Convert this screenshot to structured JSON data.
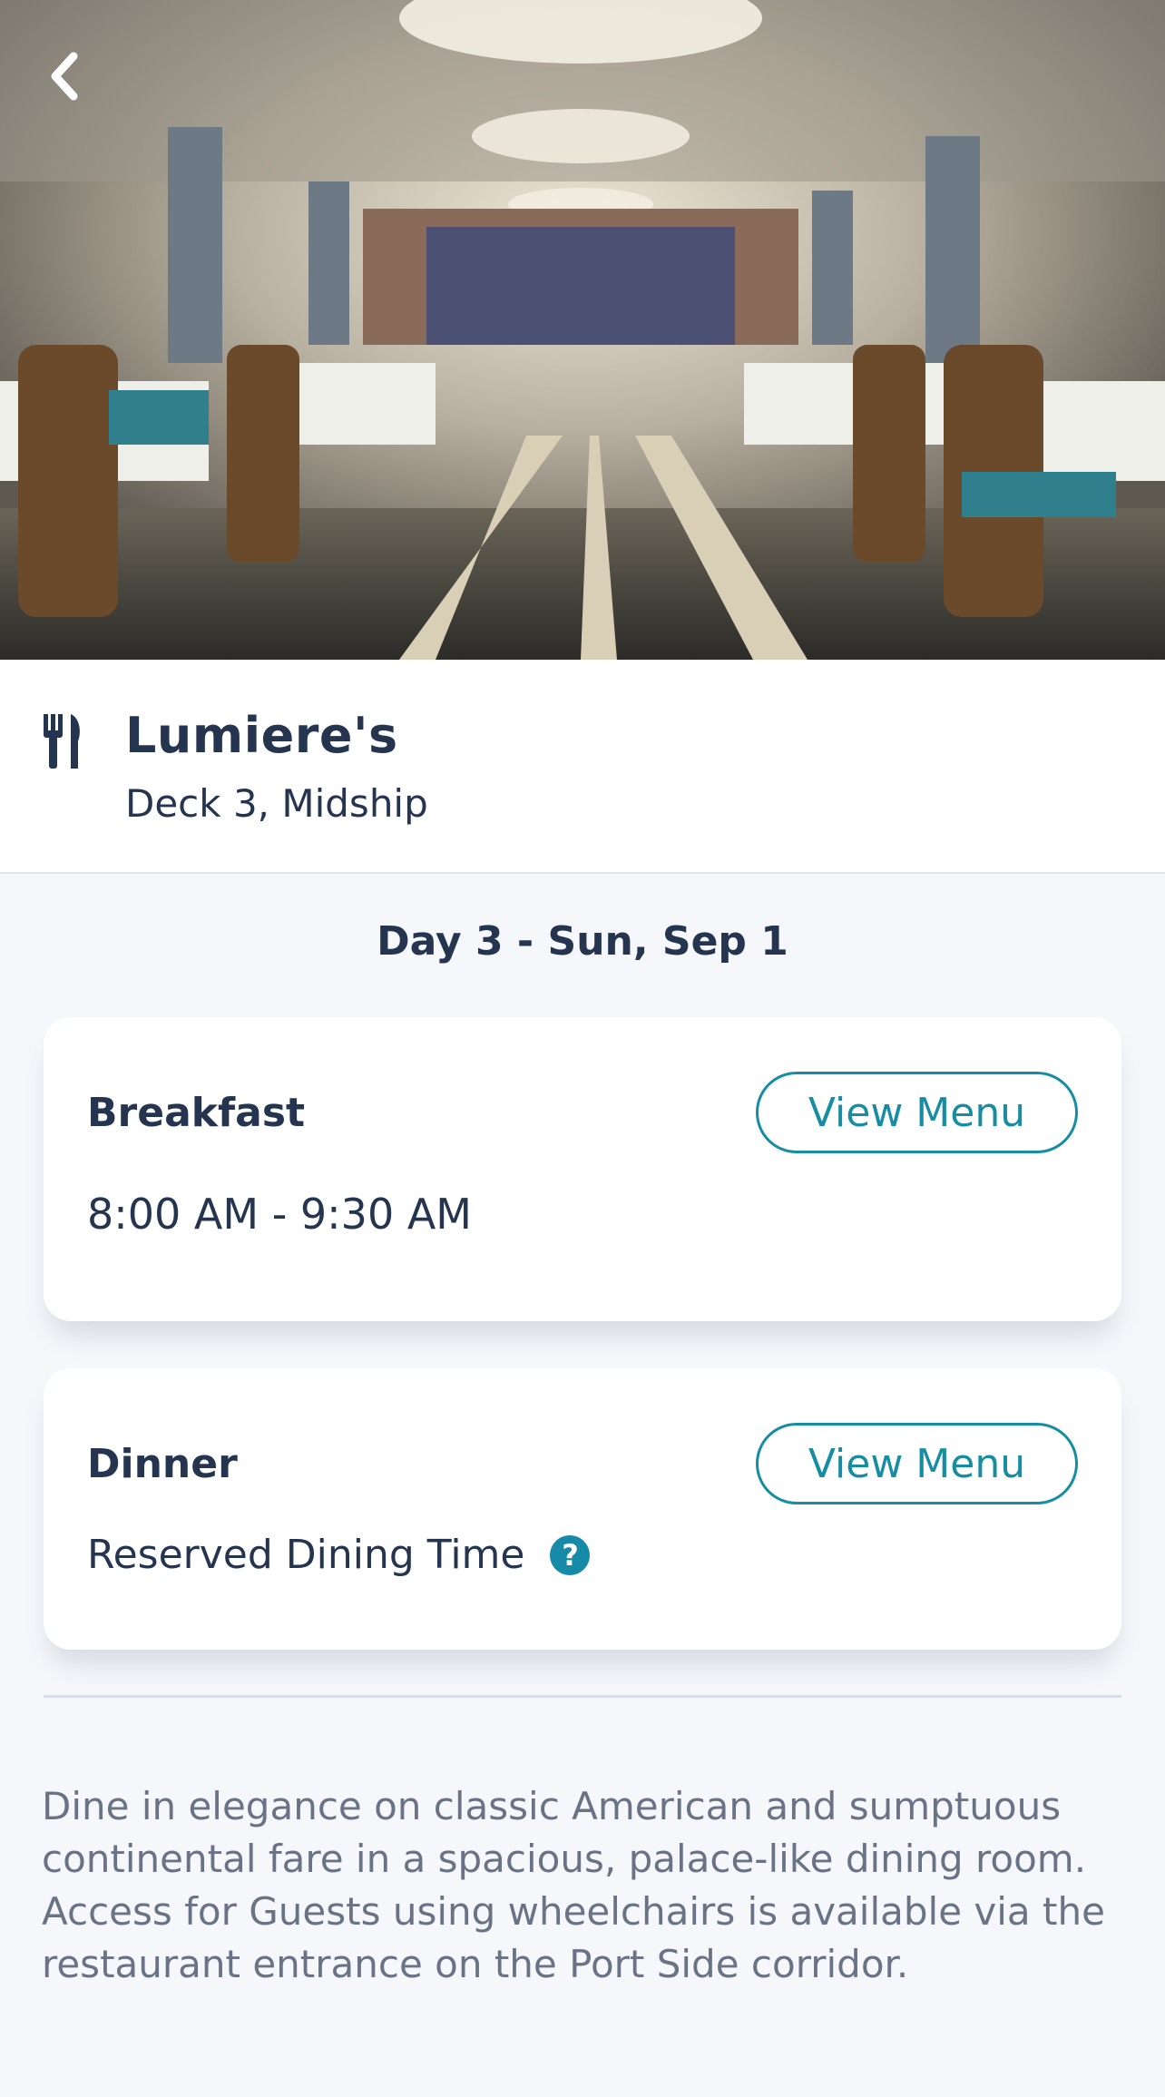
{
  "hero": {
    "image_alt": "Lumiere's dining room",
    "back_icon": "chevron-left-icon"
  },
  "restaurant": {
    "icon": "fork-knife-icon",
    "name": "Lumiere's",
    "location": "Deck 3, Midship"
  },
  "day_heading": "Day 3 - Sun, Sep 1",
  "meals": {
    "breakfast": {
      "title": "Breakfast",
      "button": "View Menu",
      "time": "8:00 AM - 9:30 AM"
    },
    "dinner": {
      "title": "Dinner",
      "button": "View Menu",
      "time": "Reserved Dining Time",
      "help_icon": "?"
    }
  },
  "description": "Dine in elegance on classic American and sumptuous continental fare in a spacious, palace-like dining room. Access for Guests using wheelchairs is available via the restaurant entrance on the Port Side corridor.",
  "colors": {
    "accent": "#178da3",
    "text": "#253550",
    "muted": "#6a7386",
    "background": "#f5f7fb"
  }
}
